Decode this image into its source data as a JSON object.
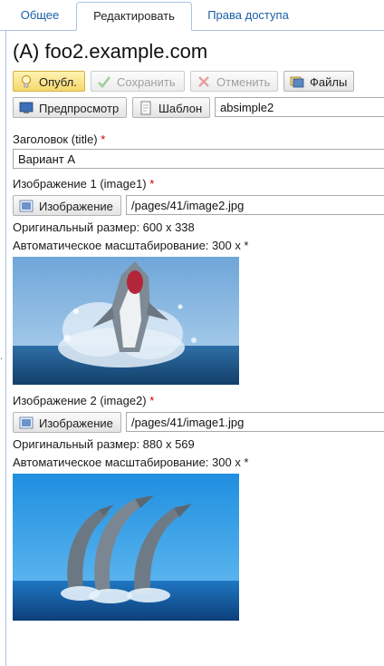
{
  "tabs": [
    "Общее",
    "Редактировать",
    "Права доступа"
  ],
  "page_title": "(A) foo2.example.com",
  "toolbar": {
    "publish": "Опубл.",
    "save": "Сохранить",
    "cancel": "Отменить",
    "files": "Файлы",
    "preview": "Предпросмотр",
    "template": "Шаблон",
    "template_value": "absimple2"
  },
  "fields": {
    "title_label": "Заголовок (title)",
    "title_value": "Вариант А",
    "image1_label": "Изображение 1 (image1)",
    "image1_button": "Изображение",
    "image1_path": "/pages/41/image2.jpg",
    "image1_original": "Оригинальный размер: 600 x 338",
    "image1_scale": "Автоматическое масштабирование: 300 x *",
    "image2_label": "Изображение 2 (image2)",
    "image2_button": "Изображение",
    "image2_path": "/pages/41/image1.jpg",
    "image2_original": "Оригинальный размер: 880 x 569",
    "image2_scale": "Автоматическое масштабирование: 300 x *"
  },
  "required_mark": "*",
  "icons": {
    "publish": "lightbulb-icon",
    "save": "checkmark-icon",
    "cancel": "cross-icon",
    "files": "files-icon",
    "preview": "monitor-icon",
    "template": "page-icon",
    "image": "picture-icon"
  },
  "colors": {
    "tab_link": "#1a5fa8",
    "required": "#d10000",
    "publish_bg": "#f6d76b"
  }
}
